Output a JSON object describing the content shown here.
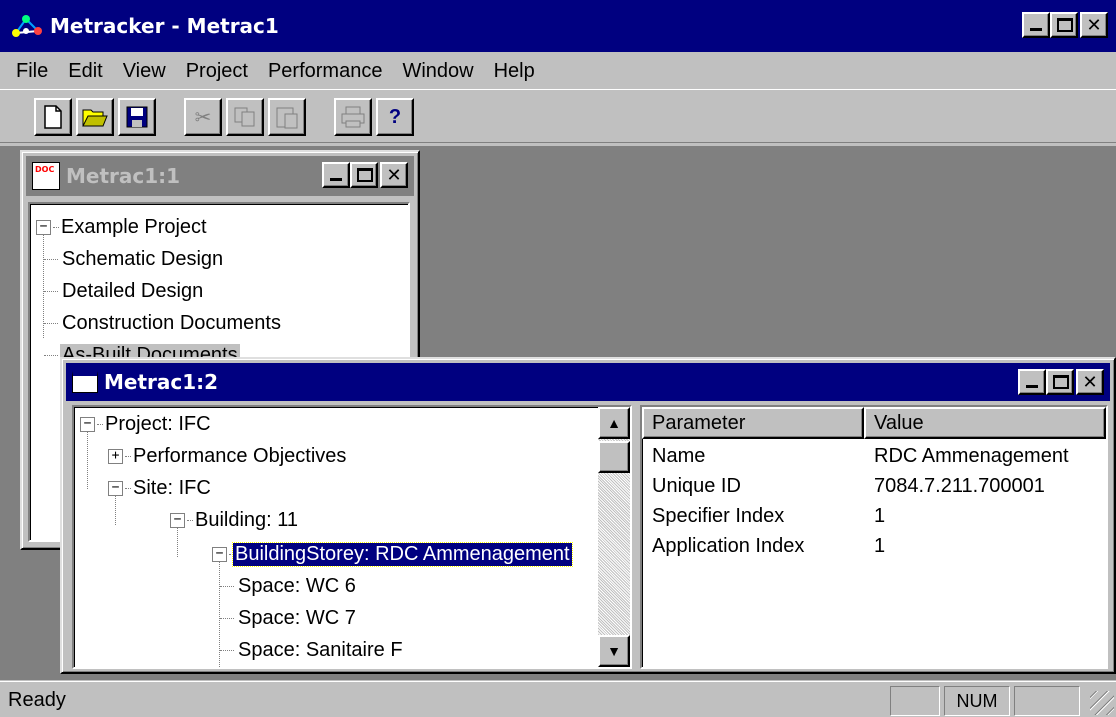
{
  "app": {
    "title": "Metracker - Metrac1",
    "icon": "network-app-icon"
  },
  "menubar": {
    "items": [
      {
        "label": "File",
        "mnemonic": "F"
      },
      {
        "label": "Edit",
        "mnemonic": "E"
      },
      {
        "label": "View",
        "mnemonic": "V"
      },
      {
        "label": "Project",
        "mnemonic": "j"
      },
      {
        "label": "Performance",
        "mnemonic": "P"
      },
      {
        "label": "Window",
        "mnemonic": "W"
      },
      {
        "label": "Help",
        "mnemonic": "H"
      }
    ]
  },
  "toolbar": {
    "buttons": [
      {
        "name": "new",
        "icon": "new-document-icon"
      },
      {
        "name": "open",
        "icon": "open-folder-icon"
      },
      {
        "name": "save",
        "icon": "save-disk-icon"
      },
      {
        "name": "cut",
        "icon": "scissors-icon",
        "disabled": true
      },
      {
        "name": "copy",
        "icon": "copy-icon",
        "disabled": true
      },
      {
        "name": "paste",
        "icon": "paste-icon",
        "disabled": true
      },
      {
        "name": "print",
        "icon": "printer-icon",
        "disabled": true
      },
      {
        "name": "help",
        "icon": "help-question-icon"
      }
    ]
  },
  "window1": {
    "title": "Metrac1:1",
    "tree": [
      {
        "label": "Example Project",
        "level": 0,
        "expander": "−"
      },
      {
        "label": "Schematic Design",
        "level": 1
      },
      {
        "label": "Detailed Design",
        "level": 1
      },
      {
        "label": "Construction Documents",
        "level": 1
      },
      {
        "label": "As-Built Documents",
        "level": 1,
        "highlighted": true
      }
    ]
  },
  "window2": {
    "title": "Metrac1:2",
    "tree": [
      {
        "label": "Project: IFC",
        "level": 0,
        "expander": "−"
      },
      {
        "label": "Performance Objectives",
        "level": 1,
        "expander": "+"
      },
      {
        "label": "Site: IFC",
        "level": 1,
        "expander": "−"
      },
      {
        "label": "Building: 11",
        "level": 2,
        "expander": "−"
      },
      {
        "label": "BuildingStorey: RDC Ammenagement",
        "level": 3,
        "expander": "−",
        "selected": true
      },
      {
        "label": "Space: WC 6",
        "level": 4
      },
      {
        "label": "Space: WC 7",
        "level": 4
      },
      {
        "label": "Space: Sanitaire F",
        "level": 4
      }
    ],
    "grid": {
      "headers": [
        "Parameter",
        "Value"
      ],
      "rows": [
        [
          "Name",
          "RDC Ammenagement"
        ],
        [
          "Unique ID",
          "7084.7.211.700001"
        ],
        [
          "Specifier Index",
          "1"
        ],
        [
          "Application Index",
          "1"
        ]
      ]
    }
  },
  "statusbar": {
    "text": "Ready",
    "panels": [
      "",
      "NUM",
      ""
    ]
  }
}
